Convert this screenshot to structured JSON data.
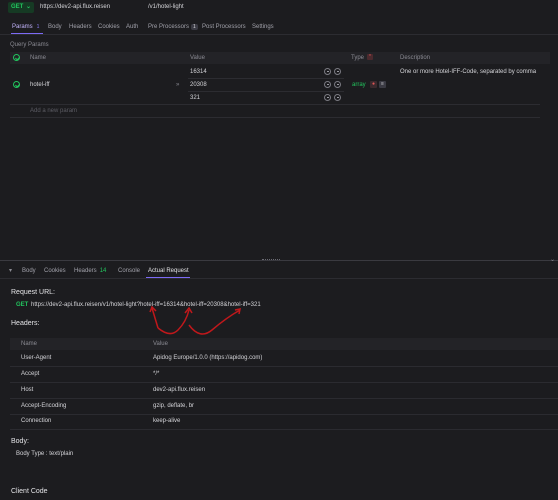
{
  "request": {
    "method": "GET",
    "base_url": "https://dev2-api.flux.reisen",
    "path": "/v1/hotel-light"
  },
  "tabs": [
    {
      "label": "Params",
      "badge": "1"
    },
    {
      "label": "Body"
    },
    {
      "label": "Headers"
    },
    {
      "label": "Cookies"
    },
    {
      "label": "Auth"
    },
    {
      "label": "Pre Processors",
      "badge": "1"
    },
    {
      "label": "Post Processors"
    },
    {
      "label": "Settings"
    }
  ],
  "query_params": {
    "section_label": "Query Params",
    "columns": {
      "name": "Name",
      "value": "Value",
      "type": "Type",
      "description": "Description"
    },
    "param": {
      "name": "hotel-iff",
      "values": [
        "16314",
        "20308",
        "321"
      ],
      "type": "array",
      "description": "One or more Hotel-IFF-Code, separated by comma"
    },
    "add_placeholder": "Add a new param"
  },
  "response_tabs": [
    {
      "label": "Body"
    },
    {
      "label": "Cookies"
    },
    {
      "label": "Headers",
      "badge": "14"
    },
    {
      "label": "Console"
    },
    {
      "label": "Actual Request"
    }
  ],
  "actual_request": {
    "request_url_label": "Request URL:",
    "method": "GET",
    "full_url": "https://dev2-api.flux.reisen/v1/hotel-light?hotel-iff=16314&hotel-iff=20308&hotel-iff=321",
    "headers_label": "Headers:",
    "header_columns": {
      "name": "Name",
      "value": "Value"
    },
    "headers": [
      {
        "name": "User-Agent",
        "value": "Apidog Europe/1.0.0 (https://apidog.com)"
      },
      {
        "name": "Accept",
        "value": "*/*"
      },
      {
        "name": "Host",
        "value": "dev2-api.flux.reisen"
      },
      {
        "name": "Accept-Encoding",
        "value": "gzip, deflate, br"
      },
      {
        "name": "Connection",
        "value": "keep-alive"
      }
    ],
    "body_label": "Body:",
    "body_type": "Body Type : text/plain",
    "client_code_label": "Client Code"
  },
  "colors": {
    "background": "#1c1c1f",
    "accent_purple": "#7c6af5",
    "method_green": "#22c55e",
    "annotation_red": "#c0181b"
  }
}
